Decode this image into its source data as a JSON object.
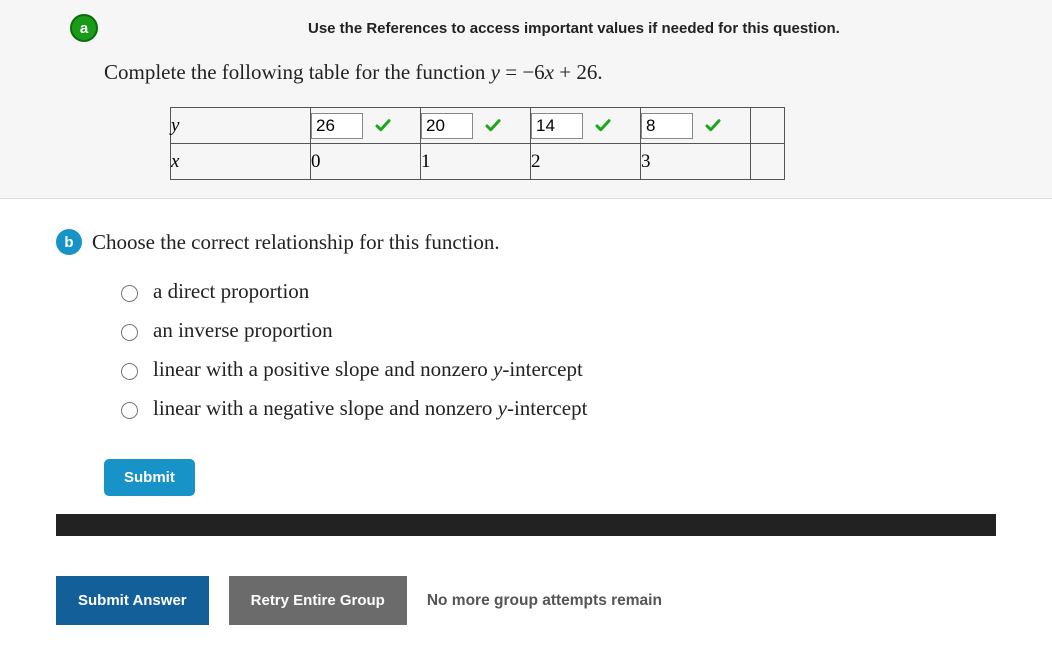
{
  "part_a": {
    "badge": "a",
    "references": "Use the References to access important values if needed for this question.",
    "prompt_prefix": "Complete the following table for the function ",
    "equation_lhs": "y",
    "equation_eq": " = ",
    "equation_rhs": "−6x + 26",
    "period": ".",
    "rows": {
      "y_label": "y",
      "x_label": "x",
      "y_values": [
        "26",
        "20",
        "14",
        "8"
      ],
      "x_values": [
        "0",
        "1",
        "2",
        "3"
      ]
    }
  },
  "part_b": {
    "badge": "b",
    "prompt": "Choose the correct relationship for this function.",
    "options": [
      {
        "text": "a direct proportion"
      },
      {
        "text": "an inverse proportion"
      },
      {
        "text_pre": "linear with a positive slope and nonzero ",
        "ital": "y",
        "text_post": "-intercept"
      },
      {
        "text_pre": "linear with a negative slope and nonzero ",
        "ital": "y",
        "text_post": "-intercept"
      }
    ],
    "submit": "Submit"
  },
  "footer": {
    "submit_answer": "Submit Answer",
    "retry": "Retry Entire Group",
    "attempts": "No more group attempts remain"
  }
}
